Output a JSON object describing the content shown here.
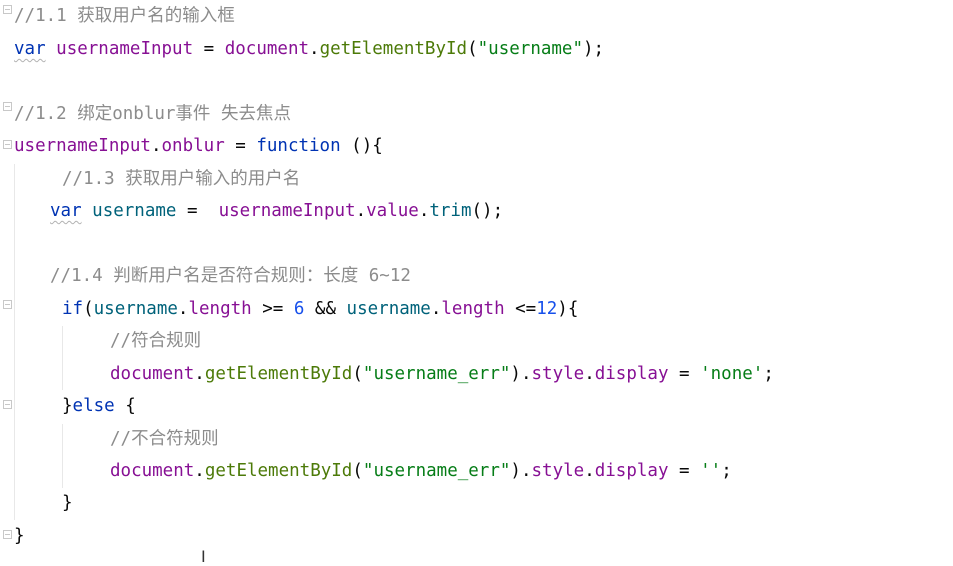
{
  "editor": {
    "lines": [
      {
        "id": "l1",
        "tokens": [
          [
            "comment",
            "//1.1 获取用户名的输入框"
          ]
        ]
      },
      {
        "id": "l2",
        "tokens": [
          [
            "kw-sq",
            "var"
          ],
          [
            "punct",
            " "
          ],
          [
            "var-decl",
            "usernameInput"
          ],
          [
            "punct",
            " = "
          ],
          [
            "global",
            "document"
          ],
          [
            "punct",
            "."
          ],
          [
            "fn",
            "getElementById"
          ],
          [
            "punct",
            "("
          ],
          [
            "str",
            "\"username\""
          ],
          [
            "punct",
            ");"
          ]
        ]
      },
      {
        "id": "l3",
        "tokens": []
      },
      {
        "id": "l4",
        "tokens": [
          [
            "comment",
            "//1.2 绑定onblur事件 失去焦点"
          ]
        ]
      },
      {
        "id": "l5",
        "tokens": [
          [
            "var-decl",
            "usernameInput"
          ],
          [
            "punct",
            "."
          ],
          [
            "prop",
            "onblur"
          ],
          [
            "punct",
            " = "
          ],
          [
            "kw",
            "function"
          ],
          [
            "punct",
            " (){"
          ]
        ]
      },
      {
        "id": "l6",
        "tokens": [
          [
            "comment",
            "//1.3 获取用户输入的用户名"
          ]
        ]
      },
      {
        "id": "l7",
        "tokens": [
          [
            "kw-sq",
            "var"
          ],
          [
            "punct",
            " "
          ],
          [
            "method",
            "username"
          ],
          [
            "punct",
            " =  "
          ],
          [
            "var-decl",
            "usernameInput"
          ],
          [
            "punct",
            "."
          ],
          [
            "prop",
            "value"
          ],
          [
            "punct",
            "."
          ],
          [
            "fn-call",
            "trim"
          ],
          [
            "punct",
            "();"
          ]
        ]
      },
      {
        "id": "l8",
        "tokens": []
      },
      {
        "id": "l9",
        "tokens": [
          [
            "comment",
            "//1.4 判断用户名是否符合规则：长度 6~12"
          ]
        ]
      },
      {
        "id": "l10",
        "tokens": [
          [
            "kw",
            "if"
          ],
          [
            "punct",
            "("
          ],
          [
            "method",
            "username"
          ],
          [
            "punct",
            "."
          ],
          [
            "prop",
            "length"
          ],
          [
            "punct",
            " >= "
          ],
          [
            "num",
            "6"
          ],
          [
            "punct",
            " && "
          ],
          [
            "method",
            "username"
          ],
          [
            "punct",
            "."
          ],
          [
            "prop",
            "length"
          ],
          [
            "punct",
            " <="
          ],
          [
            "num",
            "12"
          ],
          [
            "punct",
            "){"
          ]
        ]
      },
      {
        "id": "l11",
        "tokens": [
          [
            "comment",
            "//符合规则"
          ]
        ]
      },
      {
        "id": "l12",
        "tokens": [
          [
            "global",
            "document"
          ],
          [
            "punct",
            "."
          ],
          [
            "fn",
            "getElementById"
          ],
          [
            "punct",
            "("
          ],
          [
            "str",
            "\"username_err\""
          ],
          [
            "punct",
            ")."
          ],
          [
            "prop",
            "style"
          ],
          [
            "punct",
            "."
          ],
          [
            "prop",
            "display"
          ],
          [
            "punct",
            " = "
          ],
          [
            "str",
            "'none'"
          ],
          [
            "punct",
            ";"
          ]
        ]
      },
      {
        "id": "l13",
        "tokens": [
          [
            "punct",
            "}"
          ],
          [
            "kw",
            "else"
          ],
          [
            "punct",
            " {"
          ]
        ]
      },
      {
        "id": "l14",
        "tokens": [
          [
            "comment",
            "//不合符规则"
          ]
        ]
      },
      {
        "id": "l15",
        "tokens": [
          [
            "global",
            "document"
          ],
          [
            "punct",
            "."
          ],
          [
            "fn",
            "getElementById"
          ],
          [
            "punct",
            "("
          ],
          [
            "str",
            "\"username_err\""
          ],
          [
            "punct",
            ")."
          ],
          [
            "prop",
            "style"
          ],
          [
            "punct",
            "."
          ],
          [
            "prop",
            "display"
          ],
          [
            "punct",
            " = "
          ],
          [
            "str",
            "''"
          ],
          [
            "punct",
            ";"
          ]
        ]
      },
      {
        "id": "l16",
        "tokens": [
          [
            "punct",
            "}"
          ]
        ]
      },
      {
        "id": "l17",
        "tokens": [
          [
            "punct",
            "}"
          ]
        ]
      }
    ]
  },
  "cursor": {
    "glyph": "I"
  }
}
